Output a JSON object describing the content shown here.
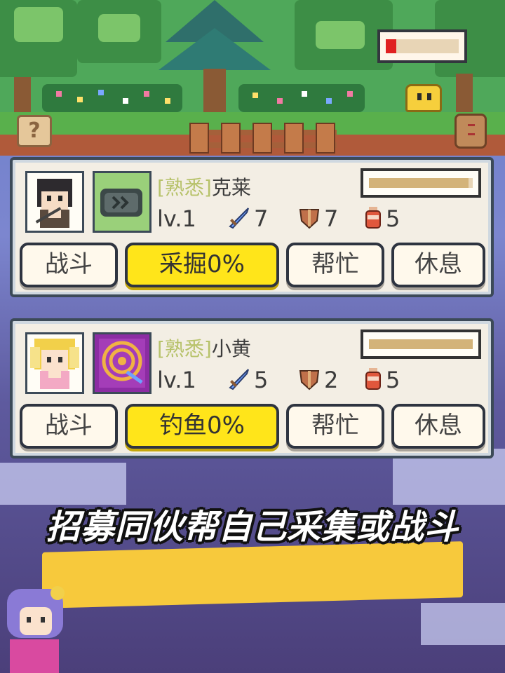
{
  "colors": {
    "primary_button": "#ffe51a",
    "enemy_hp": "#e02020",
    "companion_hp": "#d3b379",
    "caption_band": "#f7c93c"
  },
  "scene": {
    "help_button_label": "?",
    "enemy_hp_fraction": 0.14
  },
  "companions": [
    {
      "tag": "[熟悉]",
      "name": "克莱",
      "portrait_icon": "dark-haired-hero-icon",
      "tool_icon": "stone-tool-icon",
      "hp_fraction": 0.96,
      "level": "lv.1",
      "attack": "7",
      "defense": "7",
      "stamina": "5",
      "buttons": {
        "fight": "战斗",
        "job": "采掘0%",
        "help": "帮忙",
        "rest": "休息"
      }
    },
    {
      "tag": "[熟悉]",
      "name": "小黄",
      "portrait_icon": "blonde-girl-icon",
      "tool_icon": "swirl-rod-icon",
      "hp_fraction": 1.0,
      "level": "lv.1",
      "attack": "5",
      "defense": "2",
      "stamina": "5",
      "buttons": {
        "fight": "战斗",
        "job": "钓鱼0%",
        "help": "帮忙",
        "rest": "休息"
      }
    }
  ],
  "caption": "招募同伙帮自己采集或战斗"
}
